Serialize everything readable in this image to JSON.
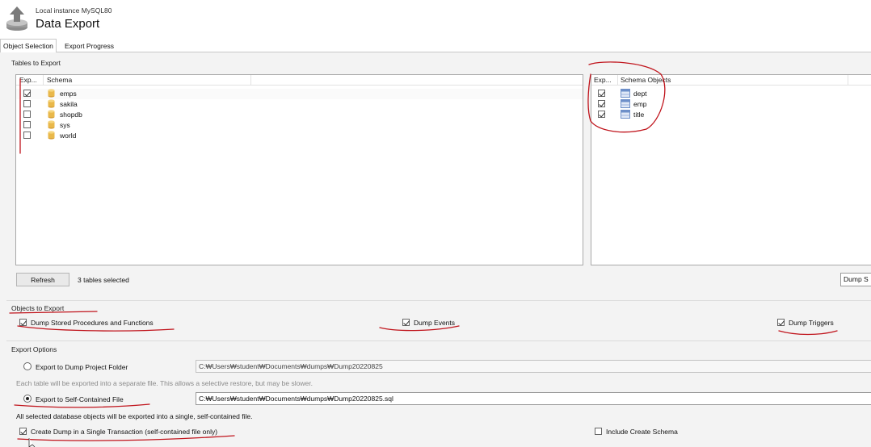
{
  "header": {
    "subtitle": "Local instance MySQL80",
    "title": "Data Export",
    "icon": "export-arrow-icon"
  },
  "tabs": [
    {
      "label": "Object Selection",
      "active": true
    },
    {
      "label": "Export Progress",
      "active": false
    }
  ],
  "tables_to_export": {
    "group_title": "Tables to Export",
    "schema_panel": {
      "col_export": "Exp...",
      "col_schema": "Schema",
      "rows": [
        {
          "checked": true,
          "name": "emps"
        },
        {
          "checked": false,
          "name": "sakila"
        },
        {
          "checked": false,
          "name": "shopdb"
        },
        {
          "checked": false,
          "name": "sys"
        },
        {
          "checked": false,
          "name": "world"
        }
      ]
    },
    "objects_panel": {
      "col_export": "Exp...",
      "col_objects": "Schema Objects",
      "rows": [
        {
          "checked": true,
          "name": "dept"
        },
        {
          "checked": true,
          "name": "emp"
        },
        {
          "checked": true,
          "name": "title"
        }
      ]
    },
    "refresh_label": "Refresh",
    "selected_status": "3 tables selected",
    "dump_select_value": "Dump S"
  },
  "objects_to_export": {
    "group_title": "Objects to Export",
    "routines": {
      "label": "Dump Stored Procedures and Functions",
      "checked": true
    },
    "events": {
      "label": "Dump Events",
      "checked": true
    },
    "triggers": {
      "label": "Dump Triggers",
      "checked": true
    }
  },
  "export_options": {
    "group_title": "Export Options",
    "project_folder": {
      "label": "Export to Dump Project Folder",
      "selected": false,
      "path": "C:₩Users₩student₩Documents₩dumps₩Dump20220825",
      "note": "Each table will be exported into a separate file. This allows a selective restore, but may be slower."
    },
    "self_contained": {
      "label": "Export to Self-Contained File",
      "selected": true,
      "path": "C:₩Users₩student₩Documents₩dumps₩Dump20220825.sql",
      "note": "All selected database objects will be exported into a single, self-contained file."
    },
    "single_transaction": {
      "label": "Create Dump in a Single Transaction (self-contained file only)",
      "checked": true
    },
    "include_schema": {
      "label": "Include Create Schema",
      "checked": false
    }
  },
  "colors": {
    "annotation": "#c0141c",
    "content_bg": "#f3f3f3",
    "db_icon": "#e9b84a",
    "table_icon": "#6d8fc9"
  }
}
